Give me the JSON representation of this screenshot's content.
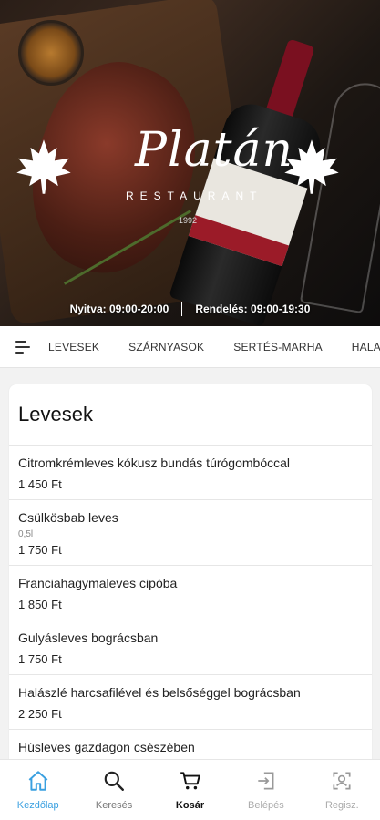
{
  "header": {
    "logo_title": "Platán",
    "logo_subtitle": "RESTAURANT",
    "logo_year": "1992",
    "opening_hours": "Nyitva: 09:00-20:00",
    "order_hours": "Rendelés: 09:00-19:30"
  },
  "categories": [
    "LEVESEK",
    "SZÁRNYASOK",
    "SERTÉS-MARHA",
    "HALA"
  ],
  "section": {
    "title": "Levesek",
    "items": [
      {
        "name": "Citromkrémleves kókusz bundás túrógombóccal",
        "note": "",
        "price": "1 450 Ft"
      },
      {
        "name": "Csülkösbab leves",
        "note": "0,5l",
        "price": "1 750 Ft"
      },
      {
        "name": "Franciahagymaleves cipóba",
        "note": "",
        "price": "1 850 Ft"
      },
      {
        "name": "Gulyásleves bográcsban",
        "note": "",
        "price": "1 750 Ft"
      },
      {
        "name": "Halászlé harcsafilével és belsőséggel bográcsban",
        "note": "",
        "price": "2 250 Ft"
      },
      {
        "name": "Húsleves gazdagon csészében",
        "note": "",
        "price": ""
      }
    ]
  },
  "nav": {
    "home": "Kezdőlap",
    "search": "Keresés",
    "cart": "Kosár",
    "login": "Belépés",
    "register": "Regisz."
  },
  "colors": {
    "accent": "#3aa0e0",
    "muted": "#aaaaaa"
  }
}
